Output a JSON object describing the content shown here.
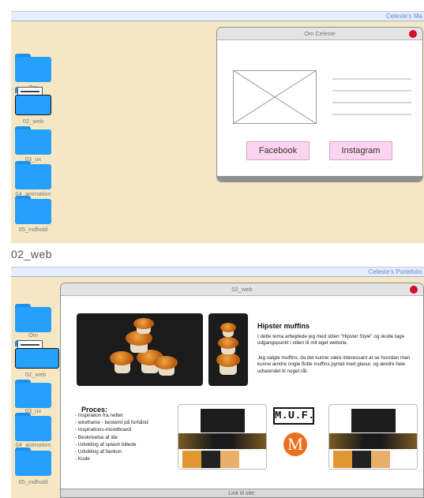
{
  "top": {
    "menubar_title": "Celeste's Ma",
    "folders": [
      {
        "label": "Om"
      },
      {
        "label": "02_web"
      },
      {
        "label": "03_ux"
      },
      {
        "label": "04_animation"
      },
      {
        "label": "05_indhold"
      }
    ],
    "window": {
      "title": "Om Celeste",
      "facebook_label": "Facebook",
      "instagram_label": "Instagram"
    }
  },
  "section_label": "02_web",
  "bottom": {
    "menubar_title": "Celeste's Portefolio",
    "folders": [
      {
        "label": "Om"
      },
      {
        "label": "02_web"
      },
      {
        "label": "03_ux"
      },
      {
        "label": "04_animation"
      },
      {
        "label": "05_indhold"
      }
    ],
    "window": {
      "title": "02_web",
      "heading": "Hipster muffins",
      "para1": "I dette tema arbejdede jeg med stilen \"Hipster Style\" og skulle tage udgangspunkt i stilen til mit eget website.",
      "para2": "Jeg valgte muffins, da det kunne være interessant at se hvordan man kunne ændre nogle flotte muffins pyntet med glasur, og ændre hele udseendet til noget råt.",
      "process_title": "Proces:",
      "process_items": [
        "- Inspiration fra nettet",
        "- wireframe - bestemt på forhånd",
        "- Inspirations-moodboard",
        "- Beskrivelse af ide",
        "- Udvikling af splash billede",
        "- Udvikling af favikon",
        "- Kode"
      ],
      "logo_text": "M.U.F.",
      "logo_letter": "M",
      "link_label": "Link til site:"
    }
  },
  "colors": {
    "desktop": "#f5e7c3",
    "folder": "#25a0fb",
    "close": "#d4102a",
    "social_button": "#fcd4ef",
    "logo_orange": "#ea6f1d"
  }
}
